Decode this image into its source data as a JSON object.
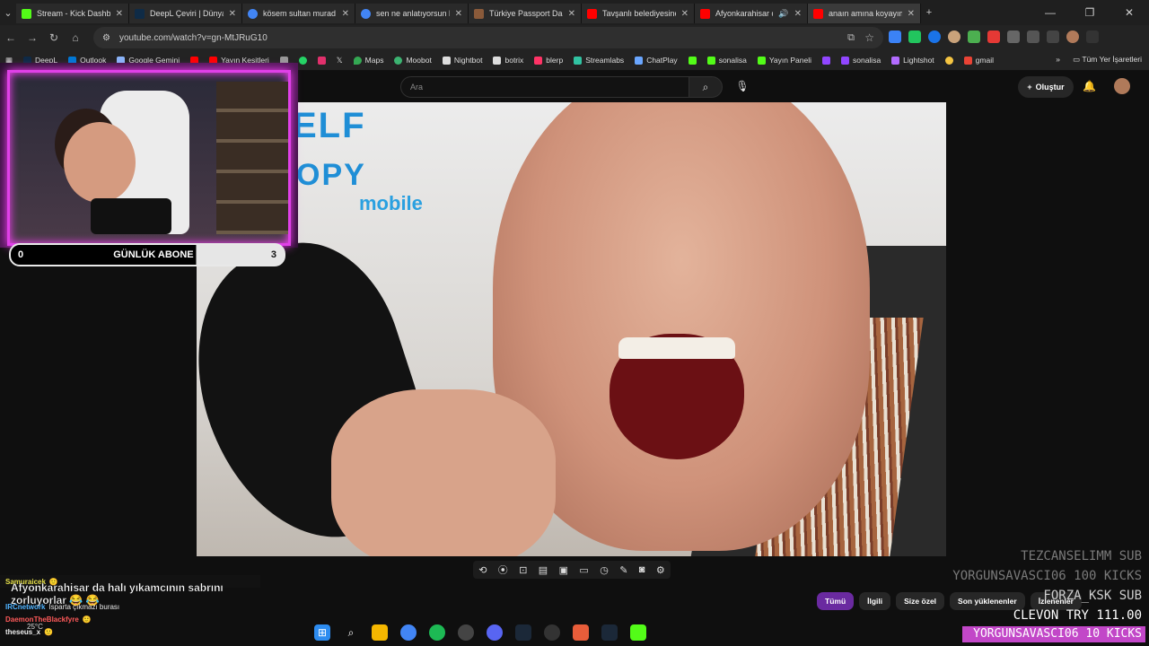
{
  "browser": {
    "tabs": [
      {
        "label": "Stream - Kick Dashboard",
        "color": "#53fc18"
      },
      {
        "label": "DeepL Çeviri | Dünyanın e",
        "color": "#0f2b46"
      },
      {
        "label": "kösem sultan murad - Go",
        "color": "#4285f4"
      },
      {
        "label": "sen ne anlatıyorsun be a",
        "color": "#4285f4"
      },
      {
        "label": "Türkiye Passport Dashbo",
        "color": "#8a5a3a"
      },
      {
        "label": "Tavşanlı belediyesine köp",
        "color": "#ff0000"
      },
      {
        "label": "Afyonkarahisar da ha",
        "color": "#ff0000"
      },
      {
        "label": "anaın amına koyayım #bu",
        "color": "#ff0000"
      }
    ],
    "url": "youtube.com/watch?v=gn-MtJRuG10",
    "bookmarks": [
      {
        "label": "DeepL",
        "color": "#0f2b46"
      },
      {
        "label": "Outlook",
        "color": "#0078d4"
      },
      {
        "label": "Google Gemini",
        "color": "#8ab4f8"
      },
      {
        "label": "",
        "color": "#ff0000"
      },
      {
        "label": "Yayın Kesitleri",
        "color": "#ff0000"
      },
      {
        "label": "",
        "color": "#999999"
      },
      {
        "label": "",
        "color": "#25d366"
      },
      {
        "label": "",
        "color": "#e1306c"
      },
      {
        "label": "",
        "color": "#ffffff"
      },
      {
        "label": "Maps",
        "color": "#34a853"
      },
      {
        "label": "Moobot",
        "color": "#3cb371"
      },
      {
        "label": "Nightbot",
        "color": "#dddddd"
      },
      {
        "label": "botrix",
        "color": "#dddddd"
      },
      {
        "label": "blerp",
        "color": "#ff3366"
      },
      {
        "label": "Streamlabs",
        "color": "#31c3a2"
      },
      {
        "label": "ChatPlay",
        "color": "#6aa6ff"
      },
      {
        "label": "",
        "color": "#53fc18"
      },
      {
        "label": "sonalisa",
        "color": "#53fc18"
      },
      {
        "label": "Yayın Paneli",
        "color": "#53fc18"
      },
      {
        "label": "",
        "color": "#9146ff"
      },
      {
        "label": "sonalisa",
        "color": "#9146ff"
      },
      {
        "label": "Lightshot",
        "color": "#b26bff"
      },
      {
        "label": "",
        "color": "#f5c542"
      },
      {
        "label": "gmail",
        "color": "#ea4335"
      }
    ],
    "all_bookmarks": "Tüm Yer İşaretleri"
  },
  "youtube": {
    "search_placeholder": "Ara",
    "create_label": "Oluştur",
    "chips": [
      "Tümü",
      "İlgili",
      "Size özel",
      "Son yüklenenler",
      "İzlenenler"
    ]
  },
  "video": {
    "logo_line1": "ELF",
    "logo_line2": "OPY",
    "logo_sub": "mobile"
  },
  "stream_overlay": {
    "sub_goal": {
      "current": "0",
      "label": "GÜNLÜK ABONE",
      "target": "3"
    },
    "alerts": [
      "TEZCANSELIMM  SUB",
      "YORGUNSAVASCI06  100 KICKS",
      "FORZA_KSK  SUB",
      "CLEVON  TRY 111.00",
      "YORGUNSAVASCI06  10 KICKS"
    ],
    "chat": [
      {
        "user": "Samuraicek",
        "text": ""
      },
      {
        "user": "",
        "text": "Afyonkarahisar da halı yıkamcının sabrını zorluyorlar 😂 😂"
      },
      {
        "user": "IRCnetwork",
        "text": "Isparta çıkmazı burası"
      },
      {
        "user": "DaemonTheBlackfyre",
        "text": ""
      },
      {
        "user": "theseus_x",
        "text": ""
      }
    ],
    "weather": "25°C"
  }
}
